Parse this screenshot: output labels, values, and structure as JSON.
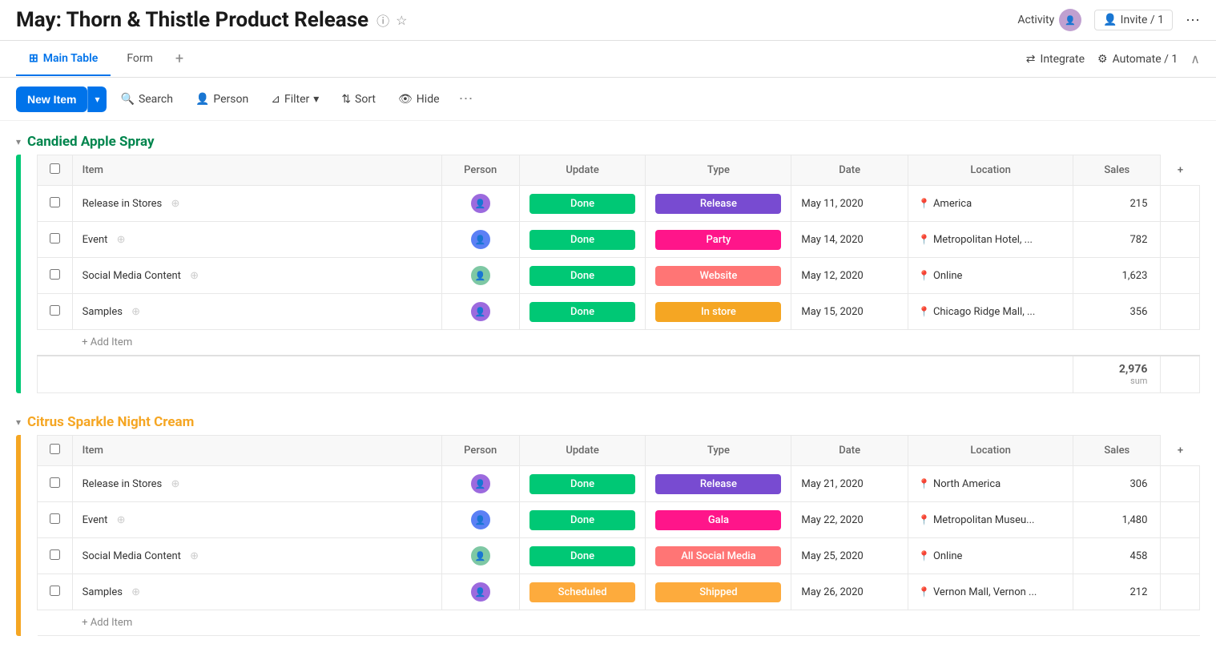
{
  "header": {
    "title": "May: Thorn & Thistle Product Release",
    "info_icon": "ℹ",
    "star_icon": "☆",
    "activity_label": "Activity",
    "invite_label": "Invite / 1",
    "more_icon": "⋯"
  },
  "tabs": {
    "main_table_label": "Main Table",
    "form_label": "Form",
    "add_icon": "+",
    "integrate_label": "Integrate",
    "automate_label": "Automate / 1"
  },
  "toolbar": {
    "new_item_label": "New Item",
    "search_label": "Search",
    "person_label": "Person",
    "filter_label": "Filter",
    "sort_label": "Sort",
    "hide_label": "Hide",
    "more_icon": "⋯"
  },
  "group1": {
    "title": "Candied Apple Spray",
    "color": "green",
    "columns": {
      "item": "Item",
      "person": "Person",
      "update": "Update",
      "type": "Type",
      "date": "Date",
      "location": "Location",
      "sales": "Sales"
    },
    "rows": [
      {
        "item": "Release in Stores",
        "update": "Done",
        "update_class": "status-done",
        "type": "Release",
        "type_class": "type-release",
        "date": "May 11, 2020",
        "location": "America",
        "sales": "215"
      },
      {
        "item": "Event",
        "update": "Done",
        "update_class": "status-done",
        "type": "Party",
        "type_class": "type-party",
        "date": "May 14, 2020",
        "location": "Metropolitan Hotel, ...",
        "sales": "782"
      },
      {
        "item": "Social Media Content",
        "update": "Done",
        "update_class": "status-done",
        "type": "Website",
        "type_class": "type-website",
        "date": "May 12, 2020",
        "location": "Online",
        "sales": "1,623"
      },
      {
        "item": "Samples",
        "update": "Done",
        "update_class": "status-done",
        "type": "In store",
        "type_class": "type-instore",
        "date": "May 15, 2020",
        "location": "Chicago Ridge Mall, ...",
        "sales": "356"
      }
    ],
    "add_item_label": "+ Add Item",
    "sum_value": "2,976",
    "sum_label": "sum"
  },
  "group2": {
    "title": "Citrus Sparkle Night Cream",
    "color": "orange",
    "columns": {
      "item": "Item",
      "person": "Person",
      "update": "Update",
      "type": "Type",
      "date": "Date",
      "location": "Location",
      "sales": "Sales"
    },
    "rows": [
      {
        "item": "Release in Stores",
        "update": "Done",
        "update_class": "status-done",
        "type": "Release",
        "type_class": "type-release",
        "date": "May 21, 2020",
        "location": "North America",
        "sales": "306"
      },
      {
        "item": "Event",
        "update": "Done",
        "update_class": "status-done",
        "type": "Gala",
        "type_class": "type-gala",
        "date": "May 22, 2020",
        "location": "Metropolitan Museu...",
        "sales": "1,480"
      },
      {
        "item": "Social Media Content",
        "update": "Done",
        "update_class": "status-done",
        "type": "All Social Media",
        "type_class": "type-allsocial",
        "date": "May 25, 2020",
        "location": "Online",
        "sales": "458"
      },
      {
        "item": "Samples",
        "update": "Scheduled",
        "update_class": "status-scheduled",
        "type": "Shipped",
        "type_class": "type-shipped",
        "date": "May 26, 2020",
        "location": "Vernon Mall, Vernon ...",
        "sales": "212"
      }
    ],
    "add_item_label": "+ Add Item"
  },
  "avatars": {
    "av1": "#9c6ade",
    "av2": "#5b80f5",
    "av3": "#e8996c"
  }
}
